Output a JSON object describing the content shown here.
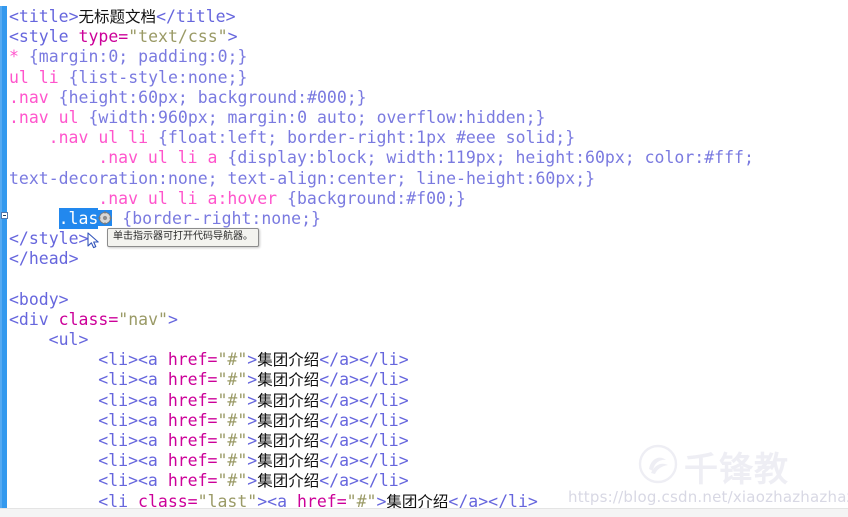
{
  "editor": {
    "kind": "code-editor",
    "language": "html",
    "colors": {
      "tag": "#6666dd",
      "attribute": "#cc0099",
      "attribute_value": "#9a9a66",
      "css_selector": "#ff55cc",
      "css_property": "#7a7ae0",
      "selection_background": "#2288ee",
      "gutter_stripe": "#3399ee",
      "text": "#111111"
    },
    "lines": [
      {
        "id": "line-title",
        "indent": 0,
        "tokens": [
          {
            "t": "tag",
            "s": "<title>"
          },
          {
            "t": "cjk",
            "s": "无标题文档"
          },
          {
            "t": "tag",
            "s": "</title>"
          }
        ]
      },
      {
        "id": "line-style-open",
        "indent": 0,
        "tokens": [
          {
            "t": "tag",
            "s": "<style "
          },
          {
            "t": "attr",
            "s": "type="
          },
          {
            "t": "val",
            "s": "\"text/css\""
          },
          {
            "t": "tag",
            "s": ">"
          }
        ]
      },
      {
        "id": "line-universal-reset",
        "indent": 0,
        "tokens": [
          {
            "t": "sel",
            "s": "* "
          },
          {
            "t": "prop",
            "s": "{margin:0; padding:0;}"
          }
        ]
      },
      {
        "id": "line-ul-li-liststyle",
        "indent": 0,
        "tokens": [
          {
            "t": "sel",
            "s": "ul li "
          },
          {
            "t": "prop",
            "s": "{list-style:none;}"
          }
        ]
      },
      {
        "id": "line-nav",
        "indent": 0,
        "tokens": [
          {
            "t": "sel",
            "s": ".nav "
          },
          {
            "t": "prop",
            "s": "{height:60px; background:#000;}"
          }
        ]
      },
      {
        "id": "line-nav-ul",
        "indent": 0,
        "tokens": [
          {
            "t": "sel",
            "s": ".nav ul "
          },
          {
            "t": "prop",
            "s": "{width:960px; margin:0 auto; overflow:hidden;}"
          }
        ]
      },
      {
        "id": "line-nav-ul-li",
        "indent": 4,
        "tokens": [
          {
            "t": "sel",
            "s": ".nav ul li "
          },
          {
            "t": "prop",
            "s": "{float:left; border-right:1px #eee solid;}"
          }
        ]
      },
      {
        "id": "line-nav-ul-li-a",
        "indent": 9,
        "tokens": [
          {
            "t": "sel",
            "s": ".nav ul li a "
          },
          {
            "t": "prop",
            "s": "{display:block; width:119px; height:60px; color:#fff;"
          }
        ]
      },
      {
        "id": "line-nav-ul-li-a-cont",
        "indent": 0,
        "tokens": [
          {
            "t": "prop",
            "s": "text-decoration:none; text-align:center; line-height:60px;}"
          }
        ]
      },
      {
        "id": "line-nav-ul-li-a-hover",
        "indent": 9,
        "tokens": [
          {
            "t": "sel",
            "s": ".nav ul li a:hover "
          },
          {
            "t": "prop",
            "s": "{background:#f00;}"
          }
        ]
      },
      {
        "id": "line-last-selected",
        "indent": 5,
        "selected_token": ".las",
        "has_nav_wheel": true,
        "tokens": [
          {
            "t": "prop",
            "s": " {border-right:none;}"
          }
        ]
      },
      {
        "id": "line-style-close",
        "indent": 0,
        "tokens": [
          {
            "t": "tag",
            "s": "</style>"
          }
        ]
      },
      {
        "id": "line-head-close",
        "indent": 0,
        "tokens": [
          {
            "t": "tag",
            "s": "</head>"
          }
        ]
      },
      {
        "id": "line-blank-1",
        "indent": 0,
        "tokens": [
          {
            "t": "blank",
            "s": " "
          }
        ]
      },
      {
        "id": "line-body-open",
        "indent": 0,
        "tokens": [
          {
            "t": "tag",
            "s": "<body>"
          }
        ]
      },
      {
        "id": "line-div-nav",
        "indent": 0,
        "tokens": [
          {
            "t": "tag",
            "s": "<div "
          },
          {
            "t": "attr",
            "s": "class="
          },
          {
            "t": "val",
            "s": "\"nav\""
          },
          {
            "t": "tag",
            "s": ">"
          }
        ]
      },
      {
        "id": "line-ul-open",
        "indent": 4,
        "tokens": [
          {
            "t": "tag",
            "s": "<ul>"
          }
        ]
      },
      {
        "id": "line-li-1",
        "indent": 9,
        "tokens": [
          {
            "t": "tag",
            "s": "<li><a "
          },
          {
            "t": "attr",
            "s": "href="
          },
          {
            "t": "val",
            "s": "\"#\""
          },
          {
            "t": "tag",
            "s": ">"
          },
          {
            "t": "cjk",
            "s": "集团介绍"
          },
          {
            "t": "tag",
            "s": "</a></li>"
          }
        ]
      },
      {
        "id": "line-li-2",
        "indent": 9,
        "tokens": [
          {
            "t": "tag",
            "s": "<li><a "
          },
          {
            "t": "attr",
            "s": "href="
          },
          {
            "t": "val",
            "s": "\"#\""
          },
          {
            "t": "tag",
            "s": ">"
          },
          {
            "t": "cjk",
            "s": "集团介绍"
          },
          {
            "t": "tag",
            "s": "</a></li>"
          }
        ]
      },
      {
        "id": "line-li-3",
        "indent": 9,
        "tokens": [
          {
            "t": "tag",
            "s": "<li><a "
          },
          {
            "t": "attr",
            "s": "href="
          },
          {
            "t": "val",
            "s": "\"#\""
          },
          {
            "t": "tag",
            "s": ">"
          },
          {
            "t": "cjk",
            "s": "集团介绍"
          },
          {
            "t": "tag",
            "s": "</a></li>"
          }
        ]
      },
      {
        "id": "line-li-4",
        "indent": 9,
        "tokens": [
          {
            "t": "tag",
            "s": "<li><a "
          },
          {
            "t": "attr",
            "s": "href="
          },
          {
            "t": "val",
            "s": "\"#\""
          },
          {
            "t": "tag",
            "s": ">"
          },
          {
            "t": "cjk",
            "s": "集团介绍"
          },
          {
            "t": "tag",
            "s": "</a></li>"
          }
        ]
      },
      {
        "id": "line-li-5",
        "indent": 9,
        "tokens": [
          {
            "t": "tag",
            "s": "<li><a "
          },
          {
            "t": "attr",
            "s": "href="
          },
          {
            "t": "val",
            "s": "\"#\""
          },
          {
            "t": "tag",
            "s": ">"
          },
          {
            "t": "cjk",
            "s": "集团介绍"
          },
          {
            "t": "tag",
            "s": "</a></li>"
          }
        ]
      },
      {
        "id": "line-li-6",
        "indent": 9,
        "tokens": [
          {
            "t": "tag",
            "s": "<li><a "
          },
          {
            "t": "attr",
            "s": "href="
          },
          {
            "t": "val",
            "s": "\"#\""
          },
          {
            "t": "tag",
            "s": ">"
          },
          {
            "t": "cjk",
            "s": "集团介绍"
          },
          {
            "t": "tag",
            "s": "</a></li>"
          }
        ]
      },
      {
        "id": "line-li-7",
        "indent": 9,
        "tokens": [
          {
            "t": "tag",
            "s": "<li><a "
          },
          {
            "t": "attr",
            "s": "href="
          },
          {
            "t": "val",
            "s": "\"#\""
          },
          {
            "t": "tag",
            "s": ">"
          },
          {
            "t": "cjk",
            "s": "集团介绍"
          },
          {
            "t": "tag",
            "s": "</a></li>"
          }
        ]
      },
      {
        "id": "line-li-last",
        "indent": 9,
        "tokens": [
          {
            "t": "tag",
            "s": "<li "
          },
          {
            "t": "attr",
            "s": "class="
          },
          {
            "t": "val",
            "s": "\"last\""
          },
          {
            "t": "tag",
            "s": "><a "
          },
          {
            "t": "attr",
            "s": "href="
          },
          {
            "t": "val",
            "s": "\"#\""
          },
          {
            "t": "tag",
            "s": ">"
          },
          {
            "t": "cjk",
            "s": "集团介绍"
          },
          {
            "t": "tag",
            "s": "</a></li>"
          }
        ]
      }
    ]
  },
  "tooltip": {
    "text": "单击指示器可打开代码导航器。"
  },
  "watermark": {
    "logo_text": "千锋教",
    "url": "https://blog.csdn.net/xiaozhazhazhazha"
  }
}
